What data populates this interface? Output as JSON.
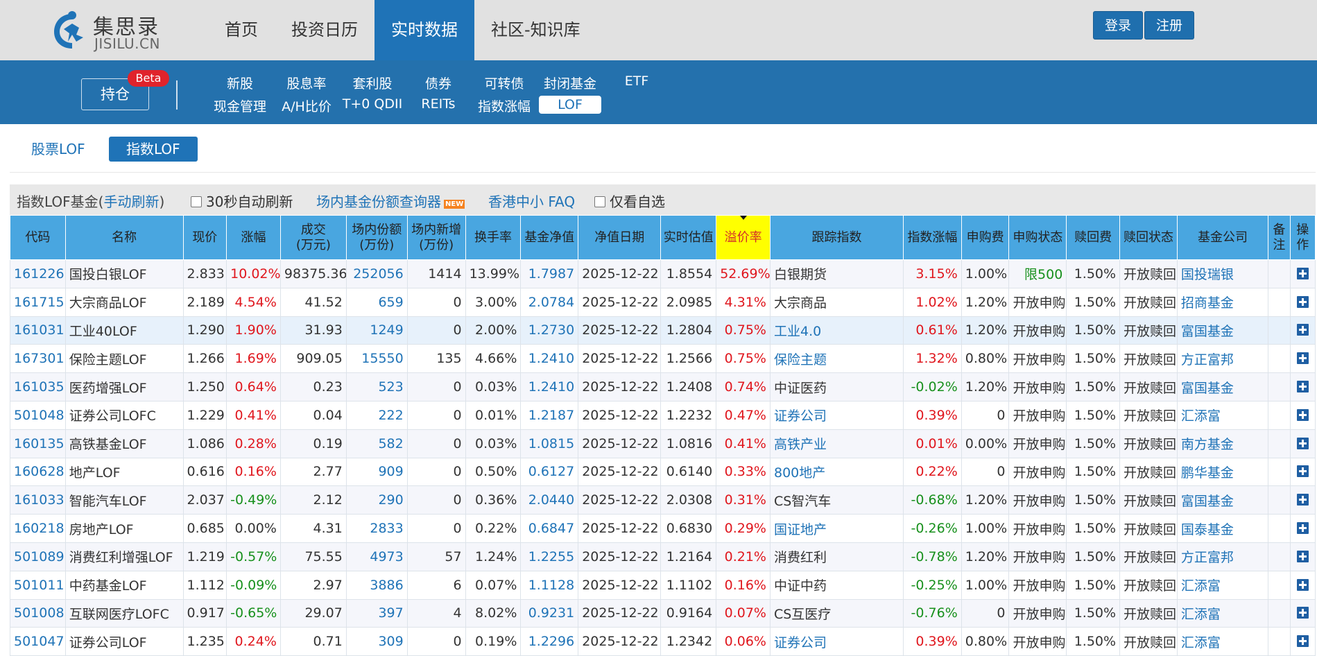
{
  "header": {
    "logo_cn": "集思录",
    "logo_en": "JISILU.CN",
    "nav": [
      "首页",
      "投资日历",
      "实时数据",
      "社区-知识库"
    ],
    "active_nav": "实时数据",
    "login": "登录",
    "register": "注册"
  },
  "subnav": {
    "holdings": "持仓",
    "beta": "Beta",
    "row1": [
      "新股",
      "股息率",
      "套利股",
      "债券",
      "可转债",
      "封闭基金",
      "ETF"
    ],
    "row2": [
      "现金管理",
      "A/H比价",
      "T+0 QDII",
      "REITs",
      "指数涨幅",
      "LOF"
    ],
    "active": "LOF"
  },
  "tabs": {
    "stock_lof": "股票LOF",
    "index_lof": "指数LOF"
  },
  "toolbar": {
    "title_prefix": "指数LOF基金(",
    "refresh": "手动刷新",
    "title_suffix": ")",
    "auto_refresh": "30秒自动刷新",
    "share_query": "场内基金份额查询器",
    "new_badge": "NEW",
    "hk_faq": "香港中小 FAQ",
    "only_favorites": "仅看自选"
  },
  "table": {
    "headers": [
      "代码",
      "名称",
      "现价",
      "涨幅",
      "成交(万元)",
      "场内份额(万份)",
      "场内新增(万份)",
      "换手率",
      "基金净值",
      "净值日期",
      "实时估值",
      "溢价率",
      "跟踪指数",
      "指数涨幅",
      "申购费",
      "申购状态",
      "赎回费",
      "赎回状态",
      "基金公司",
      "备注",
      "操作"
    ],
    "header_lines": [
      [
        "代码"
      ],
      [
        "名称"
      ],
      [
        "现价"
      ],
      [
        "涨幅"
      ],
      [
        "成交",
        "(万元)"
      ],
      [
        "场内份额",
        "(万份)"
      ],
      [
        "场内新增",
        "(万份)"
      ],
      [
        "换手率"
      ],
      [
        "基金净值"
      ],
      [
        "净值日期"
      ],
      [
        "实时估值"
      ],
      [
        "溢价率"
      ],
      [
        "跟踪指数"
      ],
      [
        "指数涨幅"
      ],
      [
        "申购费"
      ],
      [
        "申购状态"
      ],
      [
        "赎回费"
      ],
      [
        "赎回状态"
      ],
      [
        "基金公司"
      ],
      [
        "备",
        "注"
      ],
      [
        "操",
        "作"
      ]
    ],
    "sorted_column": "溢价率",
    "rows": [
      {
        "code": "161226",
        "name": "国投白银LOF",
        "price": "2.833",
        "chg": "10.02%",
        "vol": "98375.36",
        "shares": "252056",
        "new": "1414",
        "turnover": "13.99%",
        "nav": "1.7987",
        "nav_date": "2025-12-22",
        "est": "1.8554",
        "premium": "52.69%",
        "index": "白银期货",
        "index_link": false,
        "idx_chg": "3.15%",
        "buy_fee": "1.00%",
        "buy_status": "限500",
        "redeem_fee": "1.50%",
        "redeem_status": "开放赎回",
        "company": "国投瑞银"
      },
      {
        "code": "161715",
        "name": "大宗商品LOF",
        "price": "2.189",
        "chg": "4.54%",
        "vol": "41.52",
        "shares": "659",
        "new": "0",
        "turnover": "3.00%",
        "nav": "2.0784",
        "nav_date": "2025-12-22",
        "est": "2.0985",
        "premium": "4.31%",
        "index": "大宗商品",
        "index_link": false,
        "idx_chg": "1.02%",
        "buy_fee": "1.20%",
        "buy_status": "开放申购",
        "redeem_fee": "1.50%",
        "redeem_status": "开放赎回",
        "company": "招商基金"
      },
      {
        "code": "161031",
        "name": "工业40LOF",
        "price": "1.290",
        "chg": "1.90%",
        "vol": "31.93",
        "shares": "1249",
        "new": "0",
        "turnover": "2.00%",
        "nav": "1.2730",
        "nav_date": "2025-12-22",
        "est": "1.2804",
        "premium": "0.75%",
        "index": "工业4.0",
        "index_link": true,
        "idx_chg": "0.61%",
        "buy_fee": "1.20%",
        "buy_status": "开放申购",
        "redeem_fee": "1.50%",
        "redeem_status": "开放赎回",
        "company": "富国基金"
      },
      {
        "code": "167301",
        "name": "保险主题LOF",
        "price": "1.266",
        "chg": "1.69%",
        "vol": "909.05",
        "shares": "15550",
        "new": "135",
        "turnover": "4.66%",
        "nav": "1.2410",
        "nav_date": "2025-12-22",
        "est": "1.2566",
        "premium": "0.75%",
        "index": "保险主题",
        "index_link": true,
        "idx_chg": "1.32%",
        "buy_fee": "0.80%",
        "buy_status": "开放申购",
        "redeem_fee": "1.50%",
        "redeem_status": "开放赎回",
        "company": "方正富邦"
      },
      {
        "code": "161035",
        "name": "医药增强LOF",
        "price": "1.250",
        "chg": "0.64%",
        "vol": "0.23",
        "shares": "523",
        "new": "0",
        "turnover": "0.03%",
        "nav": "1.2410",
        "nav_date": "2025-12-22",
        "est": "1.2408",
        "premium": "0.74%",
        "index": "中证医药",
        "index_link": false,
        "idx_chg": "-0.02%",
        "buy_fee": "1.20%",
        "buy_status": "开放申购",
        "redeem_fee": "1.50%",
        "redeem_status": "开放赎回",
        "company": "富国基金"
      },
      {
        "code": "501048",
        "name": "证券公司LOFC",
        "price": "1.229",
        "chg": "0.41%",
        "vol": "0.04",
        "shares": "222",
        "new": "0",
        "turnover": "0.01%",
        "nav": "1.2187",
        "nav_date": "2025-12-22",
        "est": "1.2232",
        "premium": "0.47%",
        "index": "证券公司",
        "index_link": true,
        "idx_chg": "0.39%",
        "buy_fee": "0",
        "buy_status": "开放申购",
        "redeem_fee": "1.50%",
        "redeem_status": "开放赎回",
        "company": "汇添富"
      },
      {
        "code": "160135",
        "name": "高铁基金LOF",
        "price": "1.086",
        "chg": "0.28%",
        "vol": "0.19",
        "shares": "582",
        "new": "0",
        "turnover": "0.03%",
        "nav": "1.0815",
        "nav_date": "2025-12-22",
        "est": "1.0816",
        "premium": "0.41%",
        "index": "高铁产业",
        "index_link": true,
        "idx_chg": "0.01%",
        "buy_fee": "0.00%",
        "buy_status": "开放申购",
        "redeem_fee": "1.50%",
        "redeem_status": "开放赎回",
        "company": "南方基金"
      },
      {
        "code": "160628",
        "name": "地产LOF",
        "price": "0.616",
        "chg": "0.16%",
        "vol": "2.77",
        "shares": "909",
        "new": "0",
        "turnover": "0.50%",
        "nav": "0.6127",
        "nav_date": "2025-12-22",
        "est": "0.6140",
        "premium": "0.33%",
        "index": "800地产",
        "index_link": true,
        "idx_chg": "0.22%",
        "buy_fee": "0",
        "buy_status": "开放申购",
        "redeem_fee": "1.50%",
        "redeem_status": "开放赎回",
        "company": "鹏华基金"
      },
      {
        "code": "161033",
        "name": "智能汽车LOF",
        "price": "2.037",
        "chg": "-0.49%",
        "vol": "2.12",
        "shares": "290",
        "new": "0",
        "turnover": "0.36%",
        "nav": "2.0440",
        "nav_date": "2025-12-22",
        "est": "2.0308",
        "premium": "0.31%",
        "index": "CS智汽车",
        "index_link": false,
        "idx_chg": "-0.68%",
        "buy_fee": "1.20%",
        "buy_status": "开放申购",
        "redeem_fee": "1.50%",
        "redeem_status": "开放赎回",
        "company": "富国基金"
      },
      {
        "code": "160218",
        "name": "房地产LOF",
        "price": "0.685",
        "chg": "0.00%",
        "vol": "4.31",
        "shares": "2833",
        "new": "0",
        "turnover": "0.22%",
        "nav": "0.6847",
        "nav_date": "2025-12-22",
        "est": "0.6830",
        "premium": "0.29%",
        "index": "国证地产",
        "index_link": true,
        "idx_chg": "-0.26%",
        "buy_fee": "1.00%",
        "buy_status": "开放申购",
        "redeem_fee": "1.50%",
        "redeem_status": "开放赎回",
        "company": "国泰基金"
      },
      {
        "code": "501089",
        "name": "消费红利增强LOF",
        "price": "1.219",
        "chg": "-0.57%",
        "vol": "75.55",
        "shares": "4973",
        "new": "57",
        "turnover": "1.24%",
        "nav": "1.2255",
        "nav_date": "2025-12-22",
        "est": "1.2164",
        "premium": "0.21%",
        "index": "消费红利",
        "index_link": false,
        "idx_chg": "-0.78%",
        "buy_fee": "1.20%",
        "buy_status": "开放申购",
        "redeem_fee": "1.50%",
        "redeem_status": "开放赎回",
        "company": "方正富邦"
      },
      {
        "code": "501011",
        "name": "中药基金LOF",
        "price": "1.112",
        "chg": "-0.09%",
        "vol": "2.97",
        "shares": "3886",
        "new": "6",
        "turnover": "0.07%",
        "nav": "1.1128",
        "nav_date": "2025-12-22",
        "est": "1.1102",
        "premium": "0.16%",
        "index": "中证中药",
        "index_link": false,
        "idx_chg": "-0.25%",
        "buy_fee": "1.00%",
        "buy_status": "开放申购",
        "redeem_fee": "1.50%",
        "redeem_status": "开放赎回",
        "company": "汇添富"
      },
      {
        "code": "501008",
        "name": "互联网医疗LOFC",
        "price": "0.917",
        "chg": "-0.65%",
        "vol": "29.07",
        "shares": "397",
        "new": "4",
        "turnover": "8.02%",
        "nav": "0.9231",
        "nav_date": "2025-12-22",
        "est": "0.9164",
        "premium": "0.07%",
        "index": "CS互医疗",
        "index_link": false,
        "idx_chg": "-0.76%",
        "buy_fee": "0",
        "buy_status": "开放申购",
        "redeem_fee": "1.50%",
        "redeem_status": "开放赎回",
        "company": "汇添富"
      },
      {
        "code": "501047",
        "name": "证券公司LOF",
        "price": "1.235",
        "chg": "0.24%",
        "vol": "0.71",
        "shares": "309",
        "new": "0",
        "turnover": "0.19%",
        "nav": "1.2296",
        "nav_date": "2025-12-22",
        "est": "1.2342",
        "premium": "0.06%",
        "index": "证券公司",
        "index_link": true,
        "idx_chg": "0.39%",
        "buy_fee": "0.80%",
        "buy_status": "开放申购",
        "redeem_fee": "1.50%",
        "redeem_status": "开放赎回",
        "company": "汇添富"
      }
    ]
  },
  "colors": {
    "brand_blue": "#1f73b7",
    "up_red": "#e0161d",
    "down_green": "#17901c",
    "header_blue": "#49a6e0",
    "sorted_yellow": "#ffff00",
    "beta_red": "#e0232b"
  }
}
